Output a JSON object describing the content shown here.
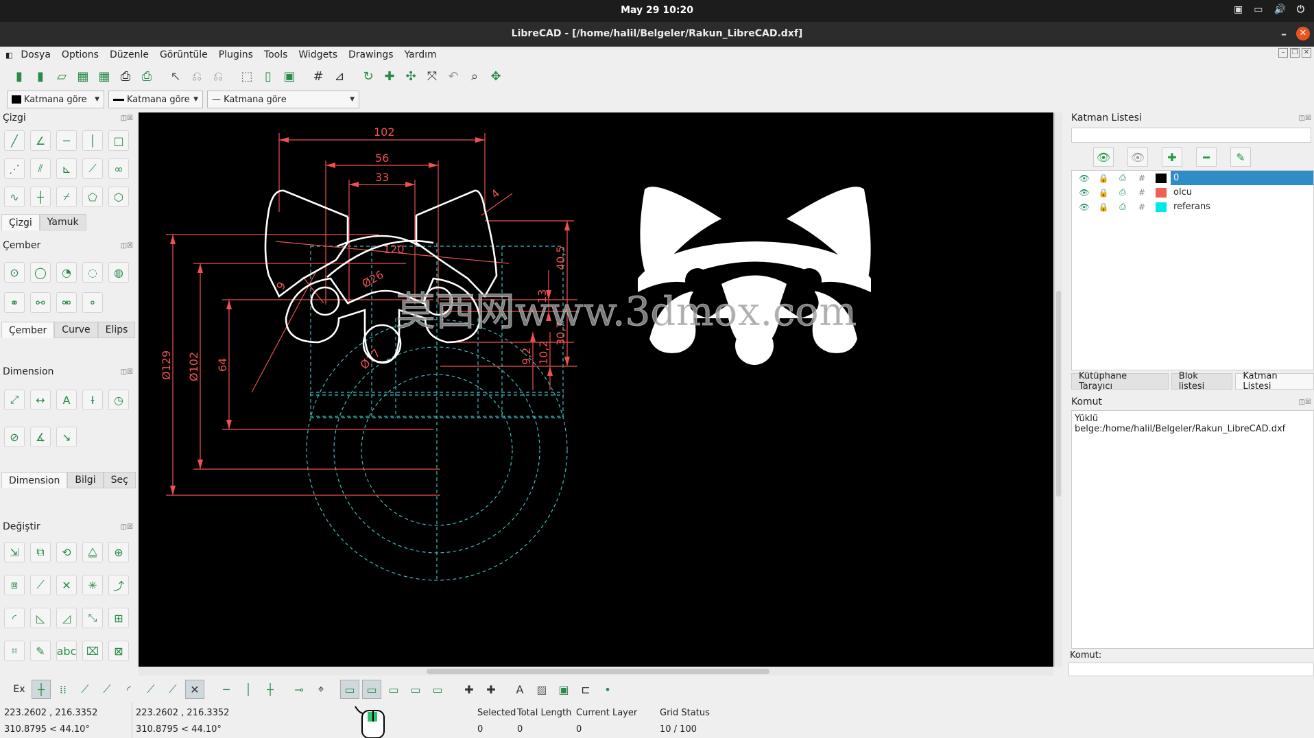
{
  "system": {
    "clock": "May 29  10:20",
    "icons": [
      "remote-desktop-icon",
      "screen-icon",
      "volume-icon",
      "power-icon"
    ]
  },
  "window": {
    "title": "LibreCAD - [/home/halil/Belgeler/Rakun_LibreCAD.dxf]",
    "minimize": "–",
    "close": "✕"
  },
  "menu": [
    "Dosya",
    "Options",
    "Düzenle",
    "Görüntüle",
    "Plugins",
    "Tools",
    "Widgets",
    "Drawings",
    "Yardım"
  ],
  "pen": {
    "color": "Katmana göre",
    "width": "Katmana göre",
    "linetype": "— Katmana göre"
  },
  "left": {
    "cizgi": {
      "title": "Çizgi",
      "tabs": [
        "Çizgi",
        "Yamuk"
      ]
    },
    "cember": {
      "title": "Çember",
      "tabs": [
        "Çember",
        "Curve",
        "Elips"
      ]
    },
    "dimension": {
      "title": "Dimension",
      "tabs": [
        "Dimension",
        "Bilgi",
        "Seç"
      ]
    },
    "degistir": {
      "title": "Değiştir"
    }
  },
  "drawing": {
    "dims": [
      "102",
      "56",
      "33",
      "120",
      "40,5",
      "13",
      "30,7",
      "9,2",
      "10,2",
      "Ø129",
      "Ø102",
      "64",
      "Ø26",
      "Ø17",
      "4",
      "9"
    ],
    "watermark": "莫西网www.3dmox.com"
  },
  "right": {
    "layer_panel_title": "Katman Listesi",
    "layers": [
      {
        "name": "0",
        "color": "#000000",
        "selected": true
      },
      {
        "name": "olcu",
        "color": "#f06050",
        "selected": false
      },
      {
        "name": "referans",
        "color": "#00e8e8",
        "selected": false
      }
    ],
    "tabs": [
      "Kütüphane Tarayıcı",
      "Blok listesi",
      "Katman Listesi"
    ],
    "command_title": "Komut",
    "command_output": "Yüklü belge:/home/halil/Belgeler/Rakun_LibreCAD.dxf",
    "command_label": "Komut:"
  },
  "status": {
    "ex": "Ex",
    "coord_abs": "223.2602 , 216.3352",
    "coord_polar": "310.8795 < 44.10°",
    "coord_rel": "223.2602 , 216.3352",
    "coord_rel_polar": "310.8795 < 44.10°",
    "selected_label": "Selected",
    "selected": "0",
    "total_length_label": "Total Length",
    "total_length": "0",
    "current_layer_label": "Current Layer",
    "current_layer": "0",
    "grid_label": "Grid Status",
    "grid": "10 / 100"
  }
}
